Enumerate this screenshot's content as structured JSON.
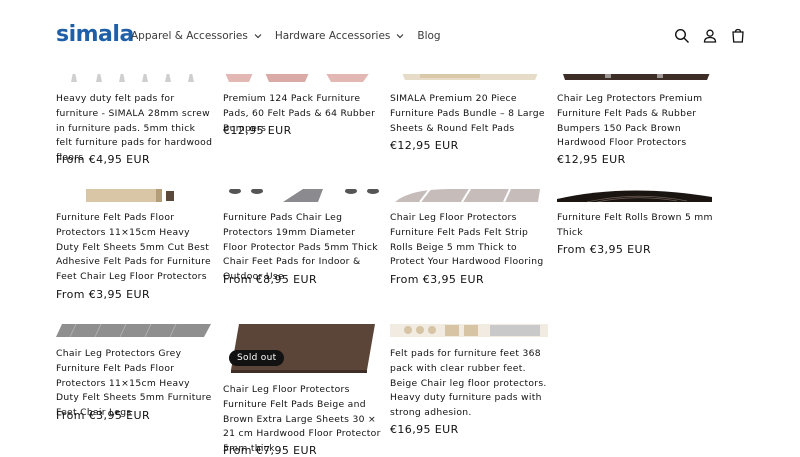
{
  "header": {
    "logo": "simala",
    "nav": [
      {
        "label": "Apparel & Accessories",
        "has_dropdown": true
      },
      {
        "label": "Hardware Accessories",
        "has_dropdown": true
      },
      {
        "label": "Blog",
        "has_dropdown": false
      }
    ],
    "icons": [
      "search-icon",
      "account-icon",
      "cart-icon"
    ]
  },
  "products": [
    {
      "title": "Heavy duty felt pads for furniture - SIMALA 28mm screw in furniture pads. 5mm thick felt furniture pads for hardwood floors",
      "price": "From €4,95 EUR"
    },
    {
      "title": "Premium 124 Pack Furniture Pads, 60 Felt Pads & 64 Rubber Bumpers",
      "price": "€12,95 EUR"
    },
    {
      "title": "SIMALA Premium 20 Piece Furniture Pads Bundle – 8 Large Sheets & Round Felt Pads",
      "price": "€12,95 EUR"
    },
    {
      "title": "Chair Leg Protectors Premium Furniture Felt Pads & Rubber Bumpers 150 Pack Brown Hardwood Floor Protectors",
      "price": "€12,95 EUR"
    },
    {
      "title": "Furniture Felt Pads Floor Protectors 11×15cm Heavy Duty Felt Sheets 5mm Cut Best Adhesive Felt Pads for Furniture Feet Chair Leg Floor Protectors",
      "price": "From €3,95 EUR"
    },
    {
      "title": "Furniture Pads Chair Leg Protectors 19mm Diameter Floor Protector Pads 5mm Thick Chair Feet Pads for Indoor & Outdoor Use",
      "price": "From €8,95 EUR"
    },
    {
      "title": "Chair Leg Floor Protectors Furniture Felt Pads Felt Strip Rolls Beige 5 mm Thick to Protect Your Hardwood Flooring",
      "price": "From €3,95 EUR"
    },
    {
      "title": "Furniture Felt Rolls Brown 5 mm Thick",
      "price": "From €3,95 EUR"
    },
    {
      "title": "Chair Leg Protectors Grey Furniture Felt Pads Floor Protectors 11×15cm Heavy Duty Felt Sheets 5mm Furniture Feet Chair Legs",
      "price": "From €3,95 EUR"
    },
    {
      "title": "Chair Leg Floor Protectors Furniture Felt Pads Beige and Brown Extra Large Sheets 30 × 21 cm Hardwood Floor Protector 5mm thick",
      "price": "From €7,95 EUR",
      "badge": "Sold out"
    },
    {
      "title": "Felt pads for furniture feet 368 pack with clear rubber feet. Beige Chair leg floor protectors. Heavy duty furniture pads with strong adhesion.",
      "price": "€16,95 EUR"
    }
  ],
  "colors": {
    "logo": "#1f5fa8",
    "text": "#121212",
    "badge_bg": "#121212"
  }
}
